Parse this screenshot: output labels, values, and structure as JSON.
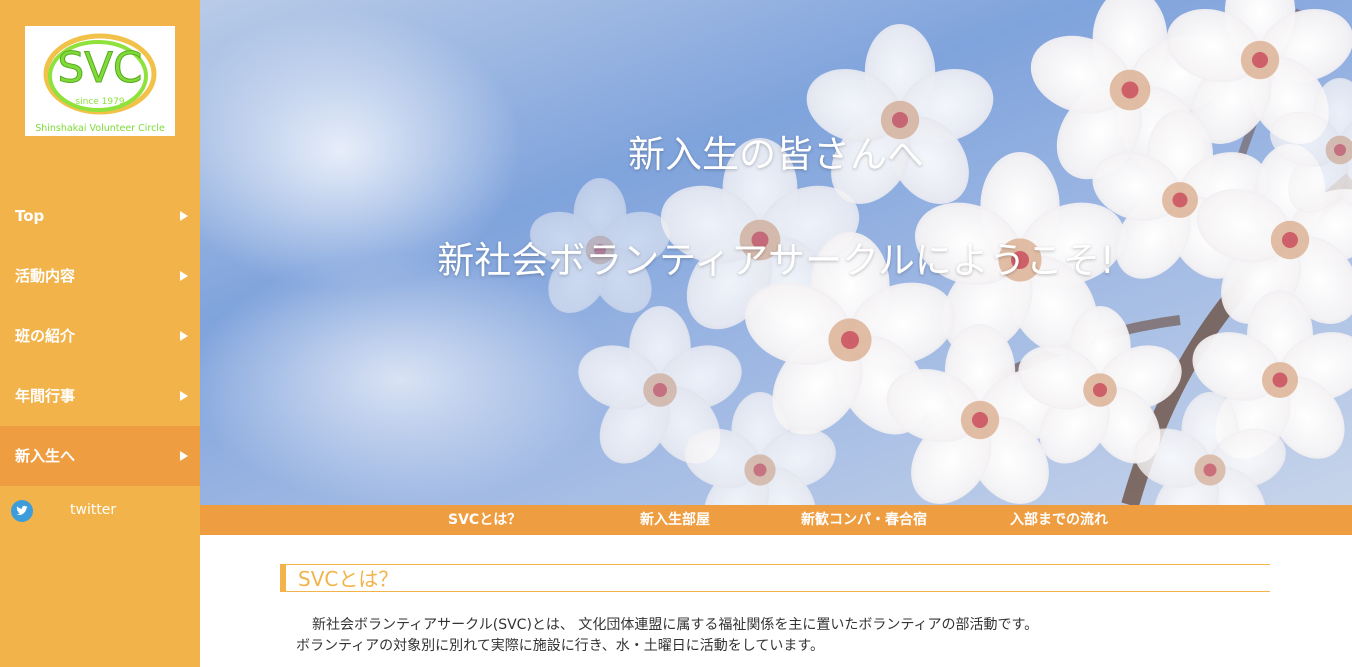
{
  "logo": {
    "title": "SVC",
    "since": "since 1979",
    "full_name": "Shinshakai Volunteer Circle"
  },
  "sidebar": {
    "items": [
      {
        "label": "Top"
      },
      {
        "label": "活動内容"
      },
      {
        "label": "班の紹介"
      },
      {
        "label": "年間行事"
      },
      {
        "label": "新入生へ",
        "active": true
      }
    ],
    "twitter_label": "twitter"
  },
  "hero": {
    "title": "新入生の皆さんへ",
    "subtitle": "新社会ボランティアサークルにようこそ!"
  },
  "subnav": {
    "items": [
      {
        "label": "SVCとは？"
      },
      {
        "label": "新入生部屋"
      },
      {
        "label": "新歓コンパ・春合宿"
      },
      {
        "label": "入部までの流れ"
      }
    ]
  },
  "content": {
    "heading": "SVCとは？",
    "paragraph_line1": "新社会ボランティアサークル(SVC)とは、 文化団体連盟に属する福祉関係を主に置いたボランティアの部活動です。",
    "paragraph_line2": "ボランティアの対象別に別れて実際に施設に行き、水・土曜日に活動をしています。"
  },
  "colors": {
    "sidebar_bg": "#f2b34a",
    "active_bg": "#ee9d40",
    "subnav_bg": "#ee9d40",
    "heading_color": "#f2b34a",
    "twitter_blue": "#3d9ddb",
    "logo_green": "#7fdc38"
  }
}
